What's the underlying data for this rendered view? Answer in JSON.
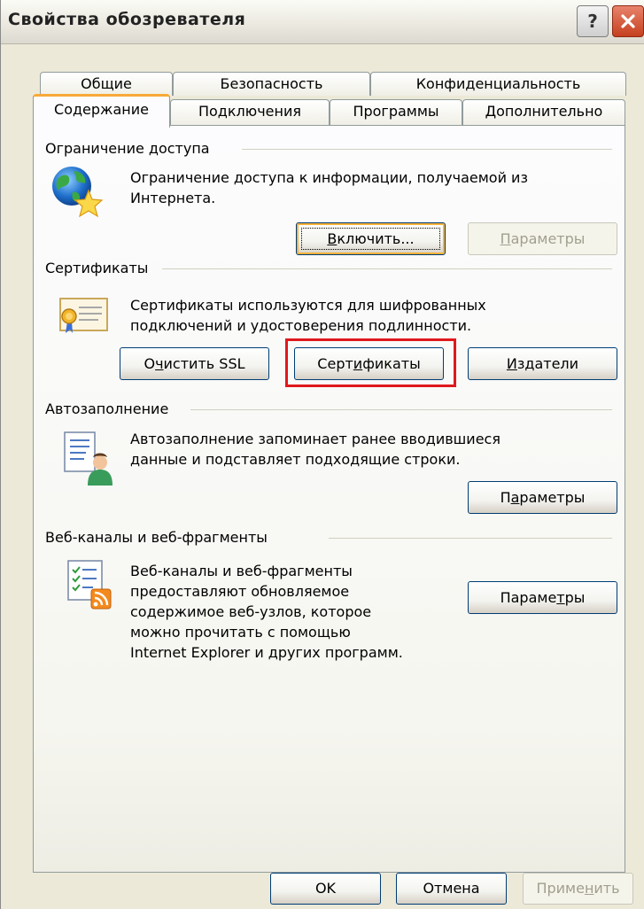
{
  "window": {
    "title": "Свойства обозревателя"
  },
  "tabs": {
    "row1": [
      "Общие",
      "Безопасность",
      "Конфиденциальность"
    ],
    "row2": [
      "Содержание",
      "Подключения",
      "Программы",
      "Дополнительно"
    ],
    "selected": "Содержание"
  },
  "content_advisor": {
    "group_label": "Ограничение доступа",
    "description_line1": "Ограничение доступа к информации, получаемой из",
    "description_line2": "Интернета.",
    "enable_button": {
      "pre": "",
      "accel": "В",
      "post": "ключить..."
    },
    "settings_button": {
      "pre": "",
      "accel": "П",
      "post": "араметры"
    }
  },
  "certificates": {
    "group_label": "Сертификаты",
    "description_line1": "Сертификаты используются для шифрованных",
    "description_line2": "подключений и удостоверения подлинности.",
    "clear_ssl_button": {
      "pre": "О",
      "accel": "ч",
      "post": "истить SSL"
    },
    "certificates_button": {
      "pre": "Серт",
      "accel": "и",
      "post": "фикаты"
    },
    "publishers_button": {
      "pre": "",
      "accel": "И",
      "post": "здатели"
    }
  },
  "autocomplete": {
    "group_label": "Автозаполнение",
    "description_line1": "Автозаполнение запоминает ранее вводившиеся",
    "description_line2": "данные и подставляет подходящие строки.",
    "settings_button": {
      "pre": "П",
      "accel": "а",
      "post": "раметры"
    }
  },
  "feeds": {
    "group_label": "Веб-каналы и веб-фрагменты",
    "description_lines": [
      "Веб-каналы и веб-фрагменты",
      "предоставляют обновляемое",
      "содержимое веб-узлов, которое",
      "можно прочитать с помощью",
      "Internet Explorer и других программ."
    ],
    "settings_button": {
      "pre": "Параме",
      "accel": "т",
      "post": "ры"
    }
  },
  "footer": {
    "ok_label": "OK",
    "cancel_label": "Отмена",
    "apply_button": {
      "pre": "Приме",
      "accel": "н",
      "post": "ить"
    }
  },
  "colors": {
    "window_bg": "#ece9d8",
    "panel_bg": "#fcfcfe",
    "highlight": "#e0191c",
    "tab_accent": "#f7a93a",
    "button_border": "#003c74"
  }
}
